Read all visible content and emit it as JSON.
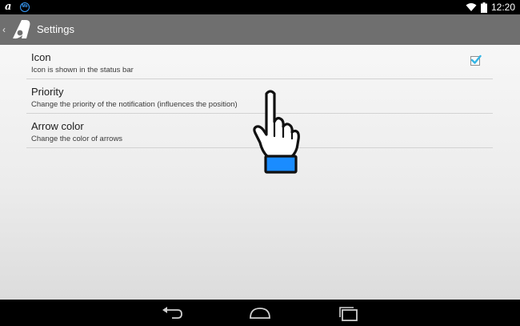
{
  "status_bar": {
    "time": "12:20",
    "notification_icon_text": "Mb"
  },
  "action_bar": {
    "title": "Settings",
    "app_logo": "a"
  },
  "preferences": [
    {
      "title": "Icon",
      "summary": "Icon is shown in the status bar",
      "checked": true
    },
    {
      "title": "Priority",
      "summary": "Change the priority of the notification (influences the position)"
    },
    {
      "title": "Arrow color",
      "summary": "Change the color of arrows"
    }
  ],
  "colors": {
    "action_bar": "#6f6f6f",
    "checkbox_accent": "#33b5e5",
    "cuff": "#1a8cff"
  },
  "icons": {
    "status_left": [
      "app-logo-icon",
      "notification-icon"
    ],
    "status_right": [
      "wifi-icon",
      "battery-icon"
    ],
    "nav": [
      "back-icon",
      "home-icon",
      "recent-apps-icon"
    ],
    "overlay": "pointing-hand-icon"
  }
}
